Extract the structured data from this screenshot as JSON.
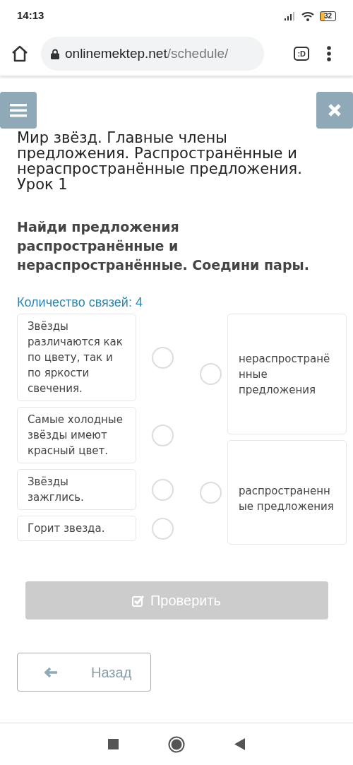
{
  "status_bar": {
    "time": "14:13",
    "battery": "32"
  },
  "browser": {
    "domain": "onlinemektep.net",
    "path": "/schedule/",
    "tabs_label": ":D"
  },
  "lesson_title": "Мир звёзд. Главные члены предложения. Распространённые и нераспространённые предложения. Урок 1",
  "task": "Найди предложения распространённые и нераспространённые. Соедини пары.",
  "links_count": "Количество связей: 4",
  "left_items": [
    {
      "text": "Звёзды различаются как по цвету, так и по яркости свечения.",
      "selected": false
    },
    {
      "text": "Самые холодные звёзды имеют красный цвет.",
      "selected": false
    },
    {
      "text": "Звёзды зажглись.",
      "selected": false
    },
    {
      "text": "Горит звезда.",
      "selected": false
    }
  ],
  "right_items": [
    {
      "text": "нераспространё нные предложения",
      "selected": false
    },
    {
      "text": "распространенн ые предложения",
      "selected": false
    }
  ],
  "check_button": {
    "label": "Проверить",
    "disabled": true
  },
  "back_button": {
    "label": "Назад"
  }
}
